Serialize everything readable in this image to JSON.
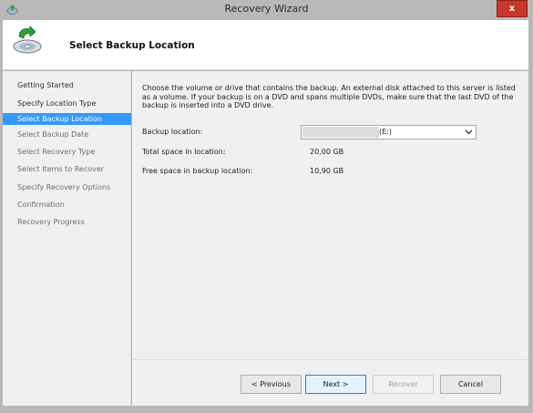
{
  "window": {
    "title": "Recovery Wizard",
    "close_label": "x",
    "title_icon": "recovery-app-icon",
    "close_icon": "close-icon"
  },
  "header": {
    "title": "Select Backup Location",
    "icon": "backup-disc-arrow-icon"
  },
  "nav": {
    "items": [
      {
        "label": "Getting Started",
        "state": "done"
      },
      {
        "label": "Specify Location Type",
        "state": "done"
      },
      {
        "label": "Select Backup Location",
        "state": "active"
      },
      {
        "label": "Select Backup Date",
        "state": "upcoming"
      },
      {
        "label": "Select Recovery Type",
        "state": "upcoming"
      },
      {
        "label": "Select Items to Recover",
        "state": "upcoming"
      },
      {
        "label": "Specify Recovery Options",
        "state": "upcoming"
      },
      {
        "label": "Confirmation",
        "state": "upcoming"
      },
      {
        "label": "Recovery Progress",
        "state": "upcoming"
      }
    ]
  },
  "main": {
    "intro": "Choose the volume or drive that contains the backup. An external disk attached to this server is listed as a volume. If your backup is on a DVD and spans multiple DVDs, make sure that the last DVD of the backup is inserted into a DVD drive.",
    "backup_location_label": "Backup location:",
    "backup_location_value": "(E:)",
    "total_space_label": "Total space in location:",
    "total_space_value": "20,00 GB",
    "free_space_label": "Free space in backup location:",
    "free_space_value": "10,90 GB"
  },
  "footer": {
    "previous_label": "< Previous",
    "next_label": "Next >",
    "recover_label": "Recover",
    "cancel_label": "Cancel"
  },
  "colors": {
    "active_nav": "#3399ff",
    "close_button": "#c8382c",
    "frame": "#b8b8b8"
  }
}
